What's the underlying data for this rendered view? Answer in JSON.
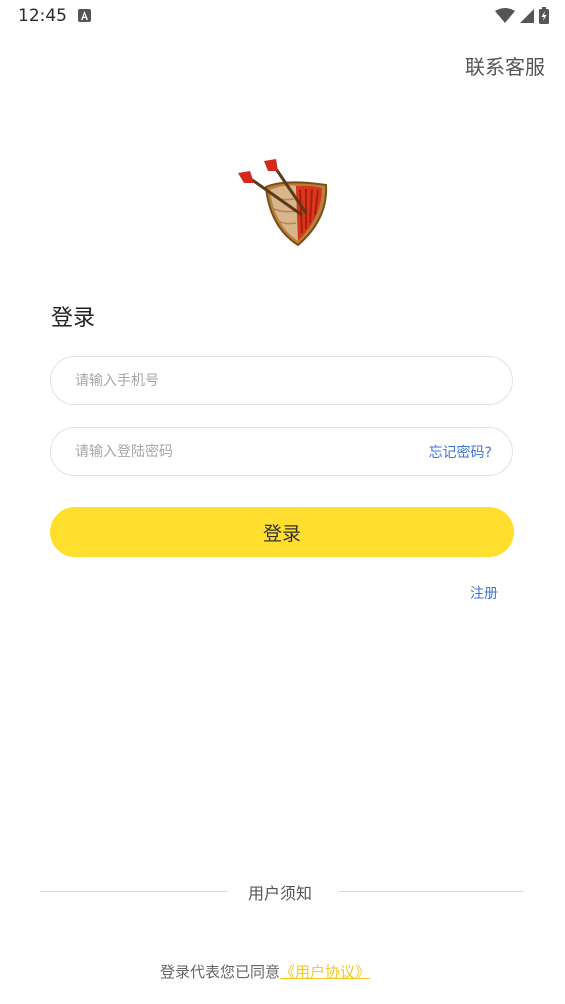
{
  "status_bar": {
    "time": "12:45",
    "icons": [
      "android-notification-icon",
      "wifi-icon",
      "signal-icon",
      "battery-charging-icon"
    ]
  },
  "header": {
    "contact_service": "联系客服"
  },
  "logo": {
    "icon": "shield-arrows-logo"
  },
  "login": {
    "title": "登录",
    "phone_placeholder": "请输入手机号",
    "password_placeholder": "请输入登陆密码",
    "forgot_password": "忘记密码?",
    "submit_label": "登录",
    "register_label": "注册"
  },
  "notice": {
    "title": "用户须知",
    "agreement_prefix": "登录代表您已同意",
    "agreement_link": "《用户协议》"
  },
  "colors": {
    "accent_yellow": "#ffde2e",
    "link_blue": "#3d76d8",
    "agreement_link": "#f2c81e"
  }
}
